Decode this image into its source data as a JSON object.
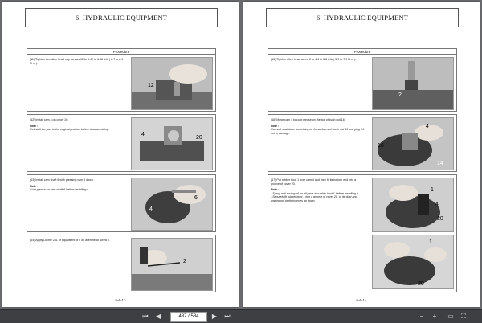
{
  "left_page": {
    "header": "6. HYDRAULIC EQUIPMENT",
    "procedure_label": "Procedure",
    "page_number": "6-6-13",
    "steps": [
      {
        "text": "(11) Tighten two allen head cap screws 12 to 6.42 to 6.88 ft-lb ( 8.7 to 8.9 N·m )."
      },
      {
        "text": "(12) Install cam 4 on cover 20.",
        "note_heading": "Note :",
        "note": "Reinstall the part to the original position before disassembling."
      },
      {
        "text": "(13) Install cam shaft 6 with pressing cam 4 down .",
        "note_heading": "Note :",
        "note": "Coat grease on cam shaft 6 before installing it."
      },
      {
        "text": "(14) Apply Loctite 241 or equivalent of it on allen head screw 2."
      }
    ]
  },
  "right_page": {
    "header": "6. HYDRAULIC EQUIPMENT",
    "procedure_label": "Procedure",
    "page_number": "6-6-14",
    "steps": [
      {
        "text": "(15) Tighten allen head screw 2 to 4.4 to 5.8 ft-lb ( 5.9 to 7.9 N·m )."
      },
      {
        "text": "(16) Move cam 4 to coat grease on the top of push rod 16.",
        "note_heading": "Note :",
        "note": "Use soft spatula or something as for surfaces of push rod 16 and plug 14 not to damage."
      },
      {
        "text": "(17) Put rubber boot 1 over cam 4 and then fit its bottom end into a groove of cover 20.",
        "note_heading": "Note :",
        "note": "- Spray anti-rusting oil on all parts in rubber boot 1 before installing it.\n- Securely fit rubber boot 1 into a groove of cover 20, or its dust and waterproof performances go down."
      }
    ]
  },
  "callouts": {
    "p1": [
      "12"
    ],
    "p2": [
      "4",
      "20"
    ],
    "p3": [
      "6",
      "4"
    ],
    "p4": [
      "2"
    ],
    "p5": [
      "2"
    ],
    "p6": [
      "4",
      "16",
      "14"
    ],
    "p7": [
      "1",
      "4",
      "20"
    ],
    "p8": [
      "1",
      "20"
    ]
  },
  "toolbar": {
    "current_page": "437",
    "total_pages": "584",
    "page_display": "437 / 584"
  }
}
